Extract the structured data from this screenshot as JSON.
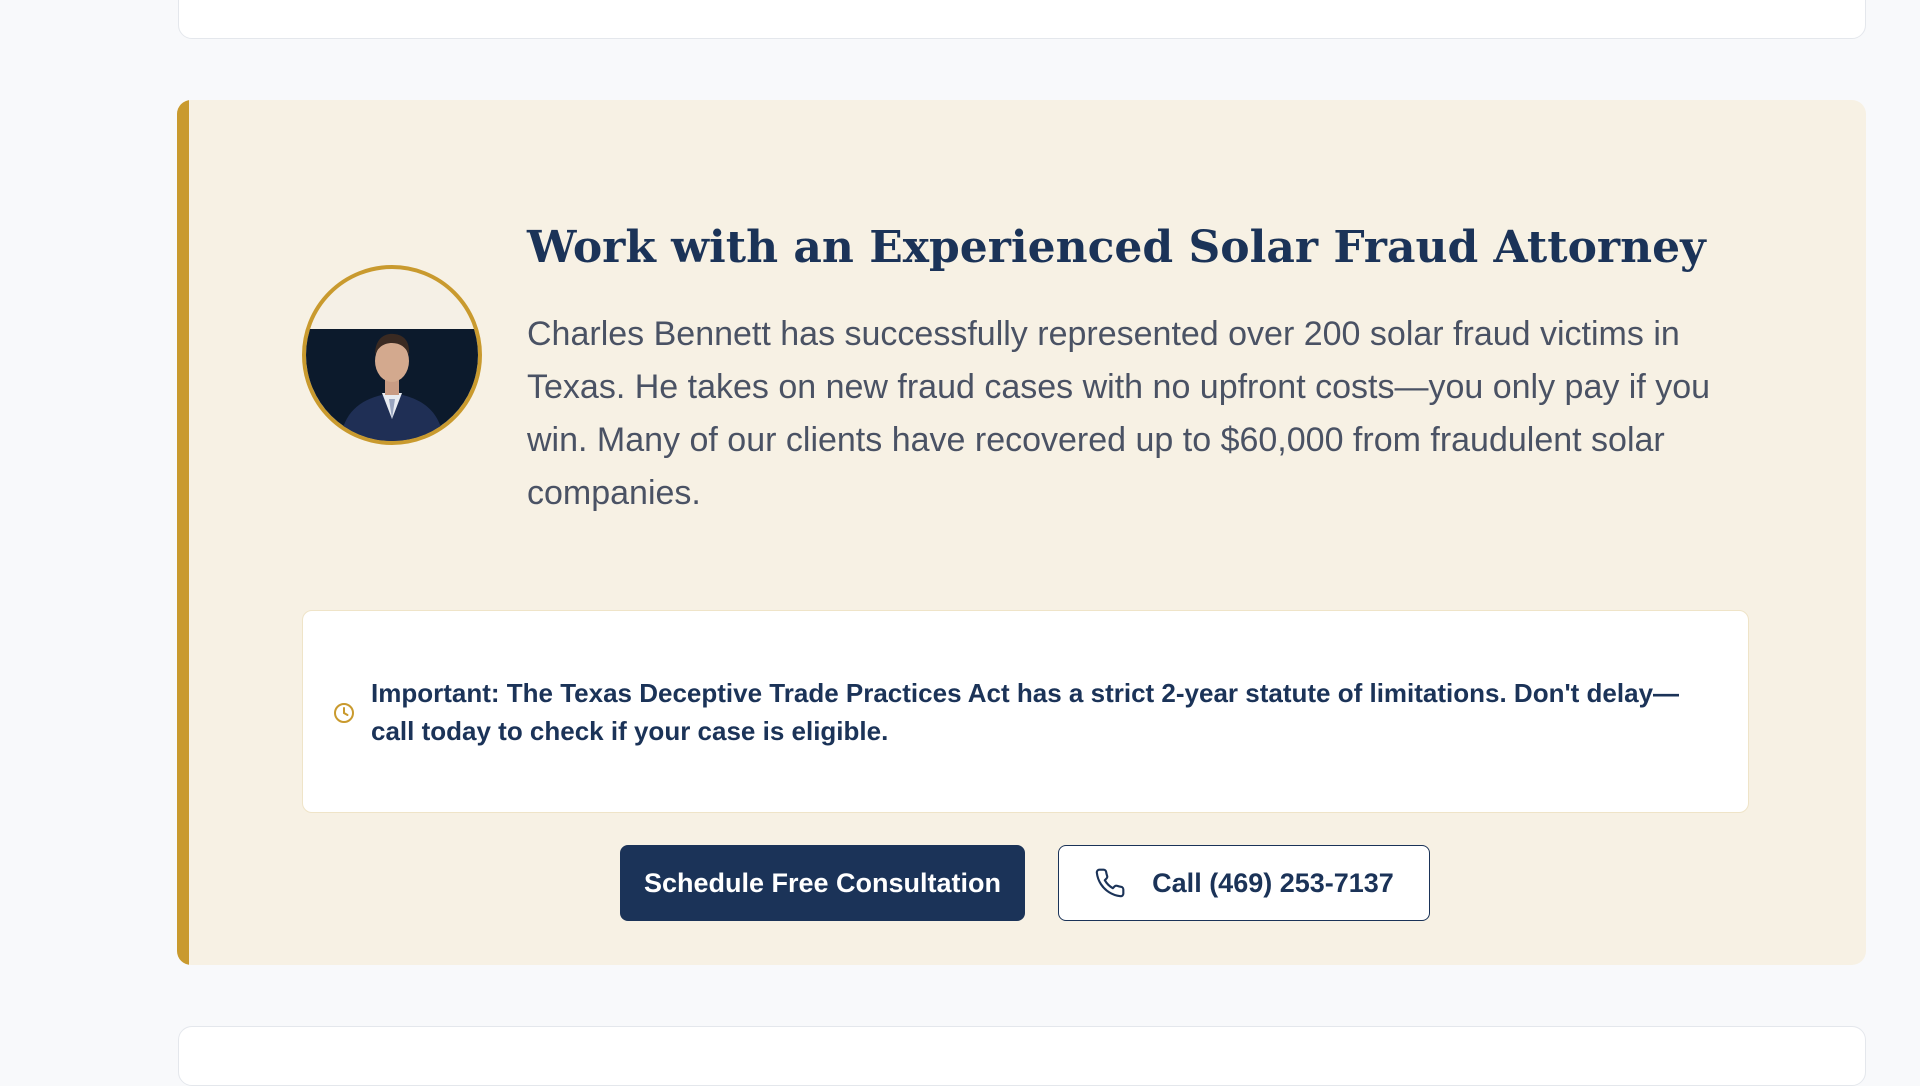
{
  "cta": {
    "heading": "Work with an Experienced Solar Fraud Attorney",
    "bio": "Charles Bennett has successfully represented over 200 solar fraud victims in Texas. He takes on new fraud cases with no upfront costs—you only pay if you win. Many of our clients have recovered up to $60,000 from fraudulent solar companies.",
    "notice": "Important: The Texas Deceptive Trade Practices Act has a strict 2-year statute of limitations. Don't delay—call today to check if your case is eligible.",
    "primary_button": "Schedule Free Consultation",
    "phone_button": "Call (469) 253-7137",
    "icons": {
      "notice": "clock-icon",
      "phone": "phone-icon"
    },
    "colors": {
      "navy": "#1b3358",
      "gold": "#c99a2e",
      "cream": "#f7f1e4",
      "body_text": "#4a5264"
    }
  }
}
